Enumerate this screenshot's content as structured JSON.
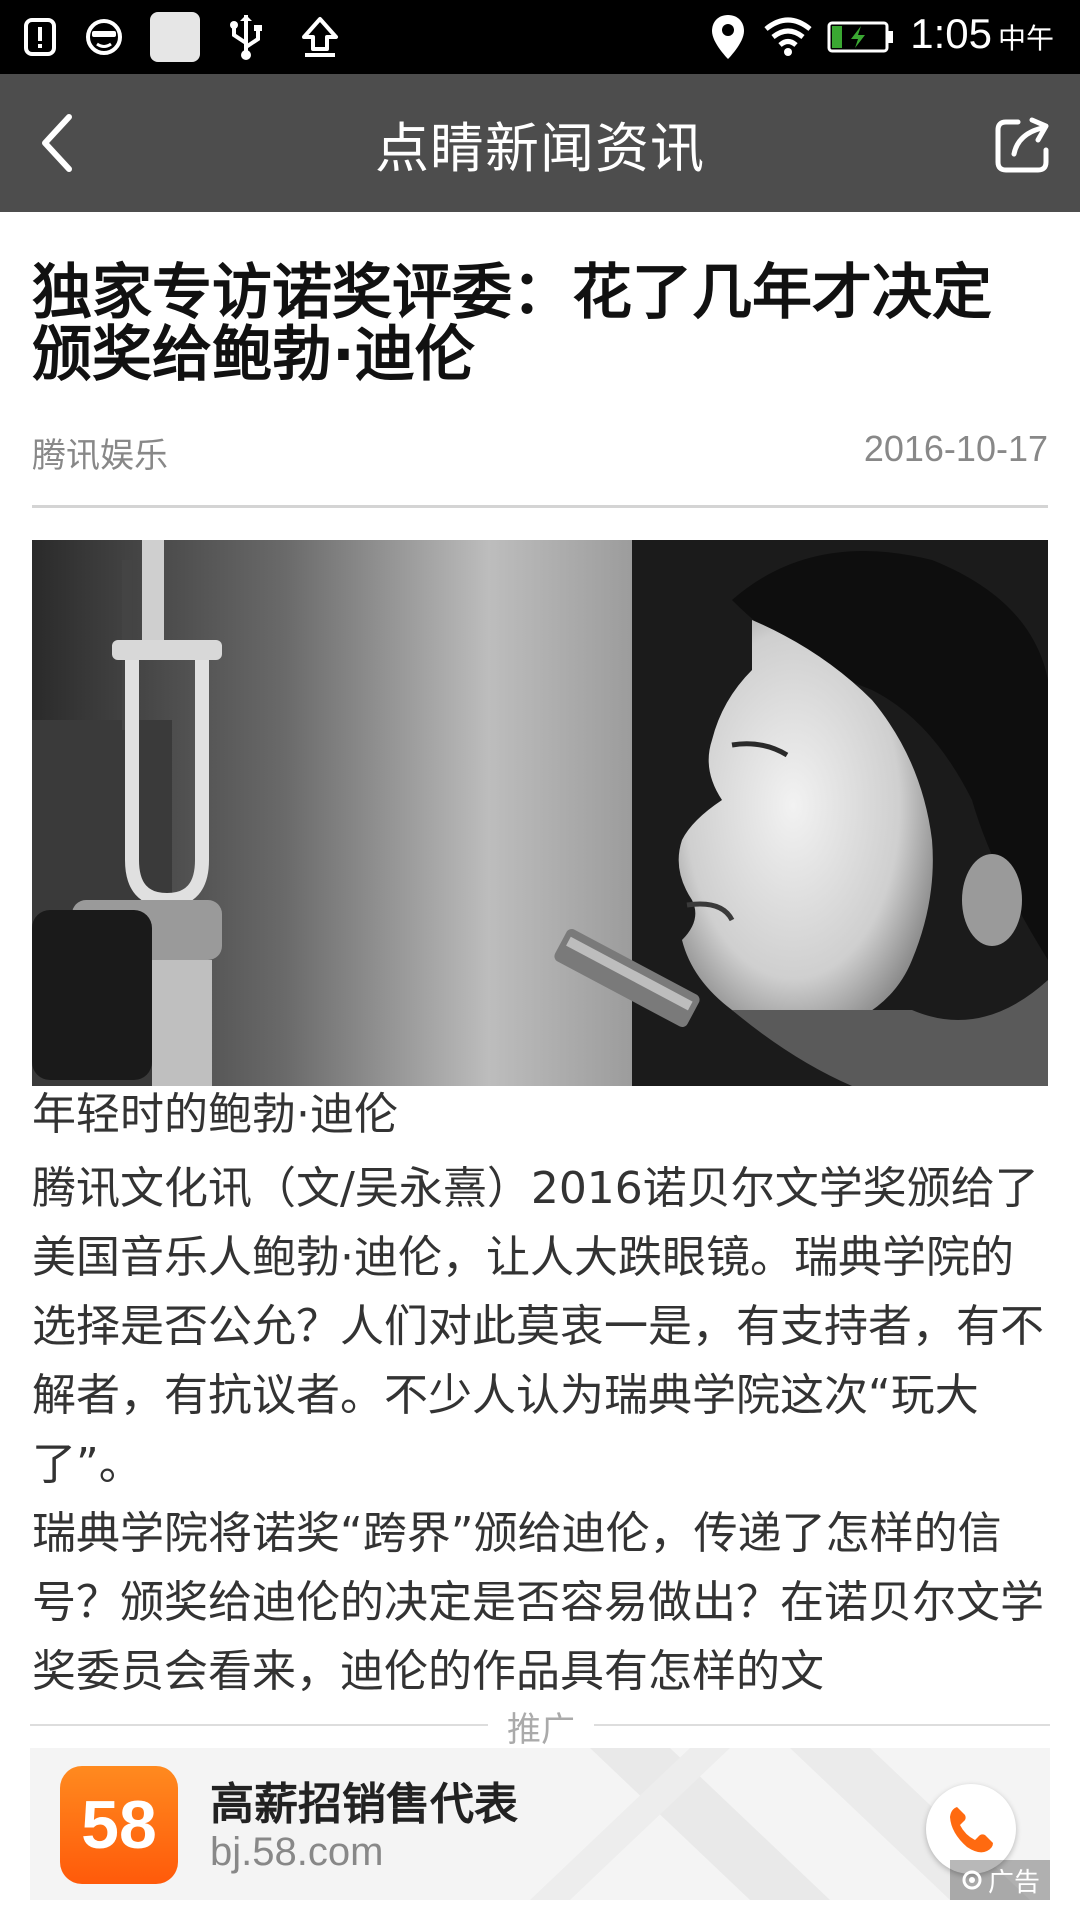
{
  "status_bar": {
    "time": "1:05",
    "am_pm": "中午",
    "icons": [
      "alert-icon",
      "face-icon",
      "square-icon",
      "usb-icon",
      "upload-icon",
      "location-icon",
      "wifi-icon",
      "battery-charging-icon"
    ]
  },
  "title_bar": {
    "title": "点睛新闻资讯",
    "back_icon": "chevron-left-icon",
    "share_icon": "share-icon"
  },
  "article": {
    "headline": "独家专访诺奖评委：花了几年才决定颁奖给鲍勃·迪伦",
    "source": "腾讯娱乐",
    "date": "2016-10-17",
    "image_caption": "年轻时的鲍勃·迪伦",
    "paragraphs": [
      "腾讯文化讯（文/吴永熹）2016诺贝尔文学奖颁给了美国音乐人鲍勃·迪伦，让人大跌眼镜。瑞典学院的选择是否公允？人们对此莫衷一是，有支持者，有不解者，有抗议者。不少人认为瑞典学院这次“玩大了”。",
      "瑞典学院将诺奖“跨界”颁给迪伦，传递了怎样的信号？颁奖给迪伦的决定是否容易做出？在诺贝尔文学奖委员会看来，迪伦的作品具有怎样的文"
    ]
  },
  "ad": {
    "section_label": "推广",
    "logo_text": "58",
    "title": "高薪招销售代表",
    "url": "bj.58.com",
    "tag": "广告",
    "logo_color": "#ff6a10"
  },
  "colors": {
    "title_bar_bg": "#4d4d4d",
    "status_bar_bg": "#000000"
  }
}
